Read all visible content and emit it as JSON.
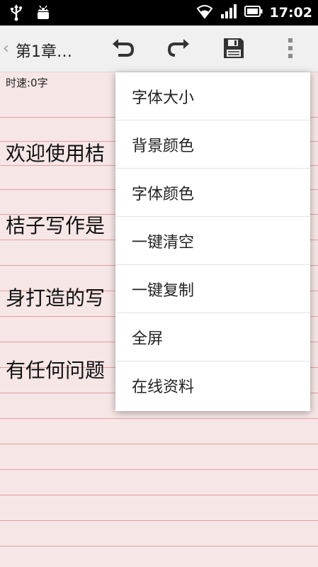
{
  "status_bar": {
    "time": "17:02",
    "icons": [
      "usb-icon",
      "android-debug-icon",
      "wifi-icon",
      "signal-icon",
      "battery-icon"
    ]
  },
  "action_bar": {
    "back_glyph": "‹",
    "title": "第1章…",
    "actions": [
      "undo-icon",
      "redo-icon",
      "save-icon",
      "overflow-menu-icon"
    ]
  },
  "editor": {
    "speed": "时速:0字",
    "lines": [
      "欢迎使用桔",
      "桔子写作是",
      "身打造的写",
      "有任何问题"
    ]
  },
  "menu": {
    "items": [
      "字体大小",
      "背景颜色",
      "字体颜色",
      "一键清空",
      "一键复制",
      "全屏",
      "在线资料"
    ]
  },
  "colors": {
    "paper": "#f7e6e6",
    "rule_line": "#e0a0a0",
    "status_bar": "#000000",
    "action_bar": "#f0f0f0"
  }
}
